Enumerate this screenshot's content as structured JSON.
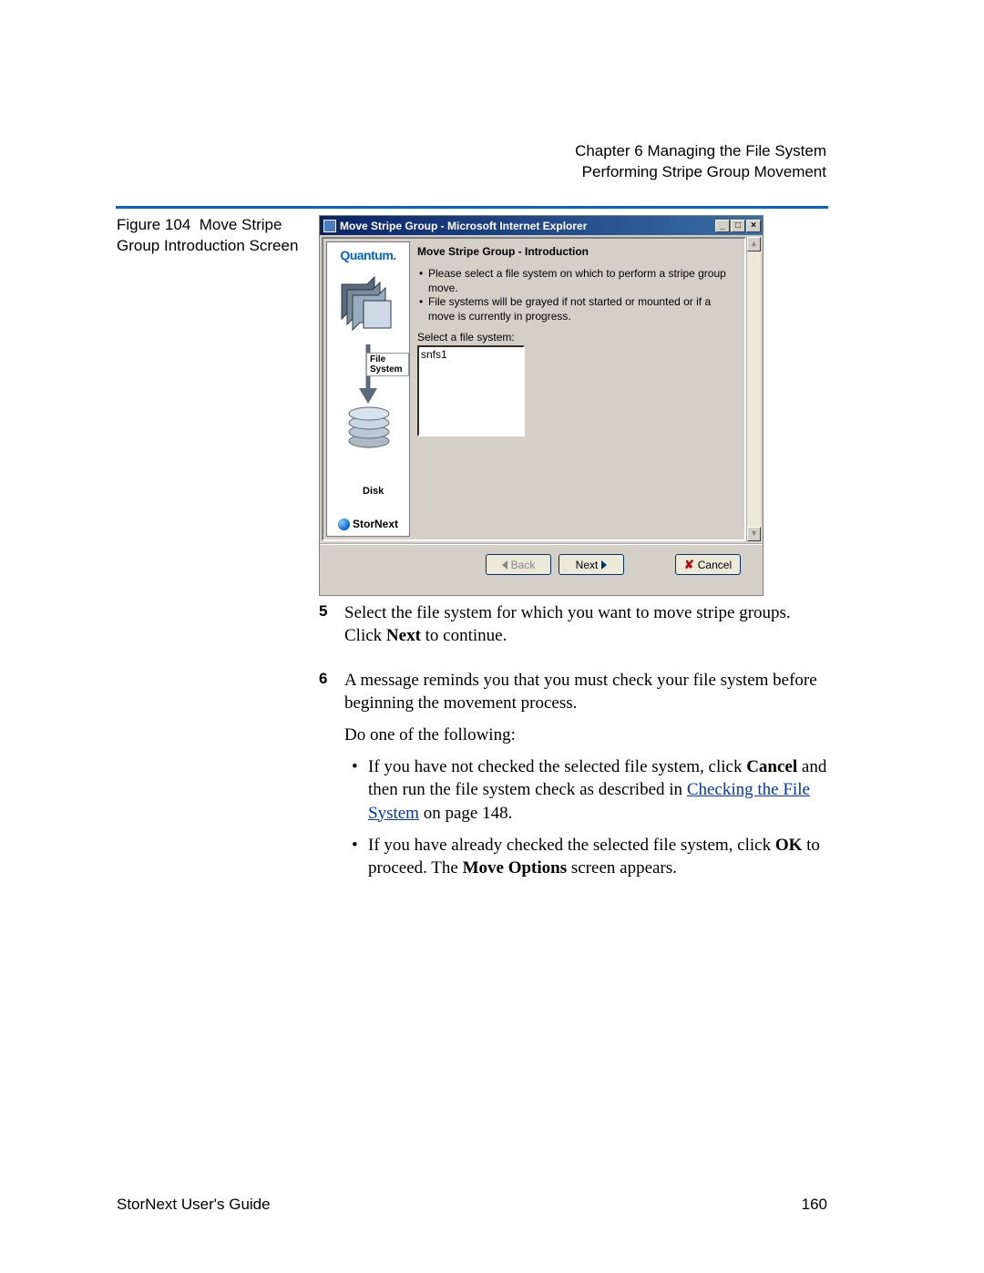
{
  "header": {
    "chapter": "Chapter 6  Managing the File System",
    "section": "Performing Stripe Group Movement"
  },
  "figure": {
    "number": "Figure 104",
    "caption": "Move Stripe Group Introduction Screen"
  },
  "window": {
    "title": "Move Stripe Group - Microsoft Internet Explorer",
    "min_glyph": "_",
    "max_glyph": "□",
    "close_glyph": "×",
    "sidebar": {
      "brand": "Quantum.",
      "fs_label": "File System",
      "disk_label": "Disk",
      "product": "StorNext"
    },
    "main": {
      "heading": "Move Stripe Group - Introduction",
      "bullet1": "Please select a file system on which to perform a stripe group move.",
      "bullet2": "File systems will be grayed if not started or mounted or if a move is currently in progress.",
      "select_label": "Select a file system:",
      "option1": "snfs1"
    },
    "buttons": {
      "back": "Back",
      "next": "Next",
      "cancel": "Cancel"
    }
  },
  "steps": {
    "s5_num": "5",
    "s5_a": "Select the file system for which you want to move stripe groups. Click ",
    "s5_b": "Next",
    "s5_c": " to continue.",
    "s6_num": "6",
    "s6_a": "A message reminds you that you must check your file system before beginning the movement process.",
    "s6_do": "Do one of the following:",
    "s6_b1a": "If you have not checked the selected file system, click ",
    "s6_b1b": "Cancel",
    "s6_b1c": " and then run the file system check as described in ",
    "s6_link": "Checking the File System",
    "s6_b1d": " on page  148.",
    "s6_b2a": "If you have already checked the selected file system, click ",
    "s6_b2b": "OK",
    "s6_b2c": " to proceed. The ",
    "s6_b2d": "Move Options",
    "s6_b2e": " screen appears."
  },
  "footer": {
    "left": "StorNext User's Guide",
    "right": "160"
  }
}
